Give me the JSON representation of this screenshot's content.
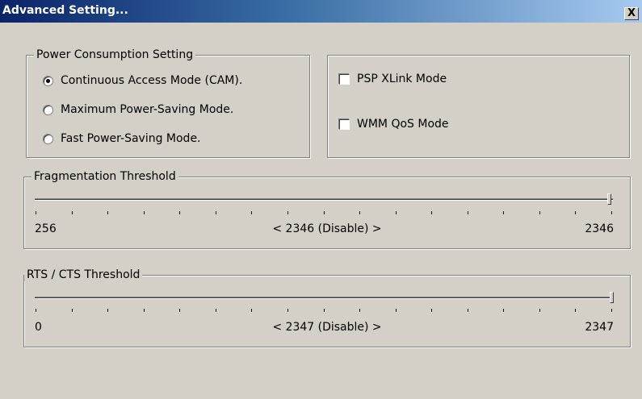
{
  "window": {
    "title": "Advanced Setting...",
    "close_label": "X"
  },
  "power": {
    "legend": "Power Consumption Setting",
    "options": [
      {
        "label": "Continuous Access Mode (CAM).",
        "selected": true
      },
      {
        "label": "Maximum Power-Saving Mode.",
        "selected": false
      },
      {
        "label": "Fast Power-Saving Mode.",
        "selected": false
      }
    ]
  },
  "modes": {
    "psp_xlink": {
      "label": "PSP XLink Mode",
      "checked": false
    },
    "wmm_qos": {
      "label": "WMM QoS Mode",
      "checked": false
    }
  },
  "fragmentation": {
    "legend": "Fragmentation Threshold",
    "min_label": "256",
    "max_label": "2346",
    "value_label": "< 2346 (Disable) >",
    "min": 256,
    "max": 2346,
    "value": 2346
  },
  "rts": {
    "legend": "RTS / CTS Threshold",
    "min_label": "0",
    "max_label": "2347",
    "value_label": "< 2347 (Disable) >",
    "min": 0,
    "max": 2347,
    "value": 2347
  }
}
